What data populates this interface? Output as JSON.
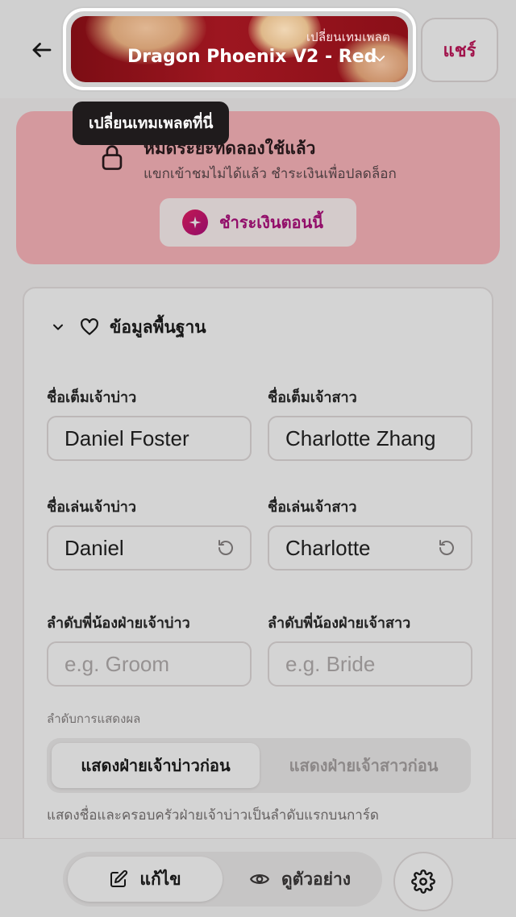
{
  "header": {
    "back_icon": "arrow-left-icon",
    "template_switcher": {
      "caption": "เปลี่ยนเทมเพลต",
      "name": "Dragon Phoenix V2 - Red",
      "icon": "chevron-down-icon"
    },
    "share_label": "แชร์"
  },
  "tooltip": {
    "text": "เปลี่ยนเทมเพลตที่นี่"
  },
  "trial_banner": {
    "icon": "lock-icon",
    "title": "หมดระยะทดลองใช้แล้ว",
    "subtitle": "แขกเข้าชมไม่ได้แล้ว ชำระเงินเพื่อปลดล็อก",
    "pay_button": {
      "icon": "sparkle-icon",
      "label": "ชำระเงินตอนนี้"
    }
  },
  "basic_info": {
    "section_title": "ข้อมูลพื้นฐาน",
    "section_icon": "heart-icon",
    "groom_full_name": {
      "label": "ชื่อเต็มเจ้าบ่าว",
      "value": "Daniel Foster"
    },
    "bride_full_name": {
      "label": "ชื่อเต็มเจ้าสาว",
      "value": "Charlotte Zhang"
    },
    "groom_nickname": {
      "label": "ชื่อเล่นเจ้าบ่าว",
      "value": "Daniel"
    },
    "bride_nickname": {
      "label": "ชื่อเล่นเจ้าสาว",
      "value": "Charlotte"
    },
    "groom_sibling_order": {
      "label": "ลำดับพี่น้องฝ่ายเจ้าบ่าว",
      "placeholder": "e.g. Groom"
    },
    "bride_sibling_order": {
      "label": "ลำดับพี่น้องฝ่ายเจ้าสาว",
      "placeholder": "e.g. Bride"
    },
    "display_order": {
      "label": "ลำดับการแสดงผล",
      "options": [
        "แสดงฝ่ายเจ้าบ่าวก่อน",
        "แสดงฝ่ายเจ้าสาวก่อน"
      ],
      "selected": "แสดงฝ่ายเจ้าบ่าวก่อน",
      "help": "แสดงชื่อและครอบครัวฝ่ายเจ้าบ่าวเป็นลำดับแรกบนการ์ด"
    }
  },
  "bottom_bar": {
    "edit_label": "แก้ไข",
    "preview_label": "ดูตัวอย่าง",
    "active_mode": "แก้ไข",
    "settings_icon": "gear-icon"
  },
  "colors": {
    "brand": "#c2185b",
    "template_red": "#9d1620",
    "banner_bg": "#ffb8bf"
  }
}
